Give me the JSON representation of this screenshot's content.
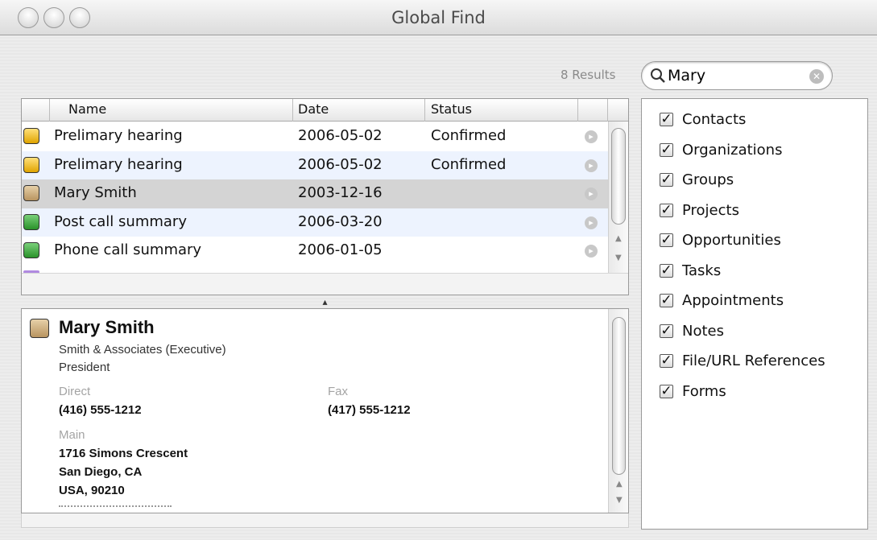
{
  "window": {
    "title": "Global Find"
  },
  "search": {
    "results_count": "8 Results",
    "query": "Mary"
  },
  "table": {
    "columns": {
      "name": "Name",
      "date": "Date",
      "status": "Status"
    },
    "rows": [
      {
        "icon": "appointment-icon",
        "name": "Prelimary hearing",
        "date": "2006-05-02",
        "status": "Confirmed"
      },
      {
        "icon": "appointment-icon",
        "name": "Prelimary hearing",
        "date": "2006-05-02",
        "status": "Confirmed"
      },
      {
        "icon": "contact-icon",
        "name": "Mary Smith",
        "date": "2003-12-16",
        "status": ""
      },
      {
        "icon": "note-icon",
        "name": "Post call summary",
        "date": "2006-03-20",
        "status": ""
      },
      {
        "icon": "note-icon",
        "name": "Phone call summary",
        "date": "2006-01-05",
        "status": ""
      }
    ]
  },
  "detail": {
    "name": "Mary Smith",
    "company": "Smith & Associates (Executive)",
    "role": "President",
    "direct_label": "Direct",
    "direct_value": "(416) 555-1212",
    "fax_label": "Fax",
    "fax_value": "(417) 555-1212",
    "main_label": "Main",
    "address_line1": "1716 Simons Crescent",
    "address_line2": "San Diego, CA",
    "address_line3": "USA, 90210"
  },
  "categories": [
    {
      "label": "Contacts",
      "checked": true
    },
    {
      "label": "Organizations",
      "checked": true
    },
    {
      "label": "Groups",
      "checked": true
    },
    {
      "label": "Projects",
      "checked": true
    },
    {
      "label": "Opportunities",
      "checked": true
    },
    {
      "label": "Tasks",
      "checked": true
    },
    {
      "label": "Appointments",
      "checked": true
    },
    {
      "label": "Notes",
      "checked": true
    },
    {
      "label": "File/URL References",
      "checked": true
    },
    {
      "label": "Forms",
      "checked": true
    }
  ]
}
